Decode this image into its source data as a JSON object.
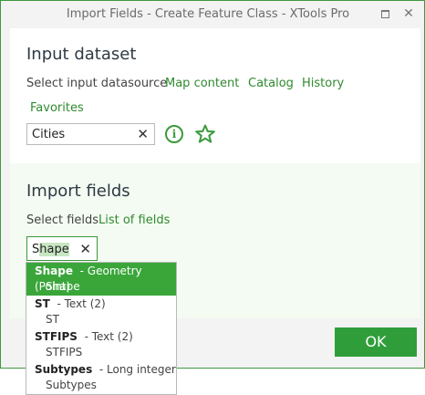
{
  "window": {
    "title": "Import Fields - Create Feature Class - XTools Pro"
  },
  "input_dataset": {
    "heading": "Input dataset",
    "select_label": "Select input datasource",
    "links": [
      "Map content",
      "Catalog",
      "History",
      "Favorites"
    ],
    "value": "Cities"
  },
  "import_fields": {
    "heading": "Import fields",
    "select_label": "Select fields",
    "link": "List of fields",
    "search_value_prefix": "S",
    "search_value_highlight": "hape",
    "options": [
      {
        "name": "Shape",
        "type": "- Geometry (Point)",
        "alias": "Shape",
        "selected": true
      },
      {
        "name": "ST",
        "type": "- Text (2)",
        "alias": "ST",
        "selected": false
      },
      {
        "name": "STFIPS",
        "type": "- Text (2)",
        "alias": "STFIPS",
        "selected": false
      },
      {
        "name": "Subtypes",
        "type": "- Long integer",
        "alias": "Subtypes",
        "selected": false
      }
    ]
  },
  "buttons": {
    "ok": "OK"
  },
  "colors": {
    "accent": "#2f9e3a",
    "link": "#2f8a2f"
  }
}
